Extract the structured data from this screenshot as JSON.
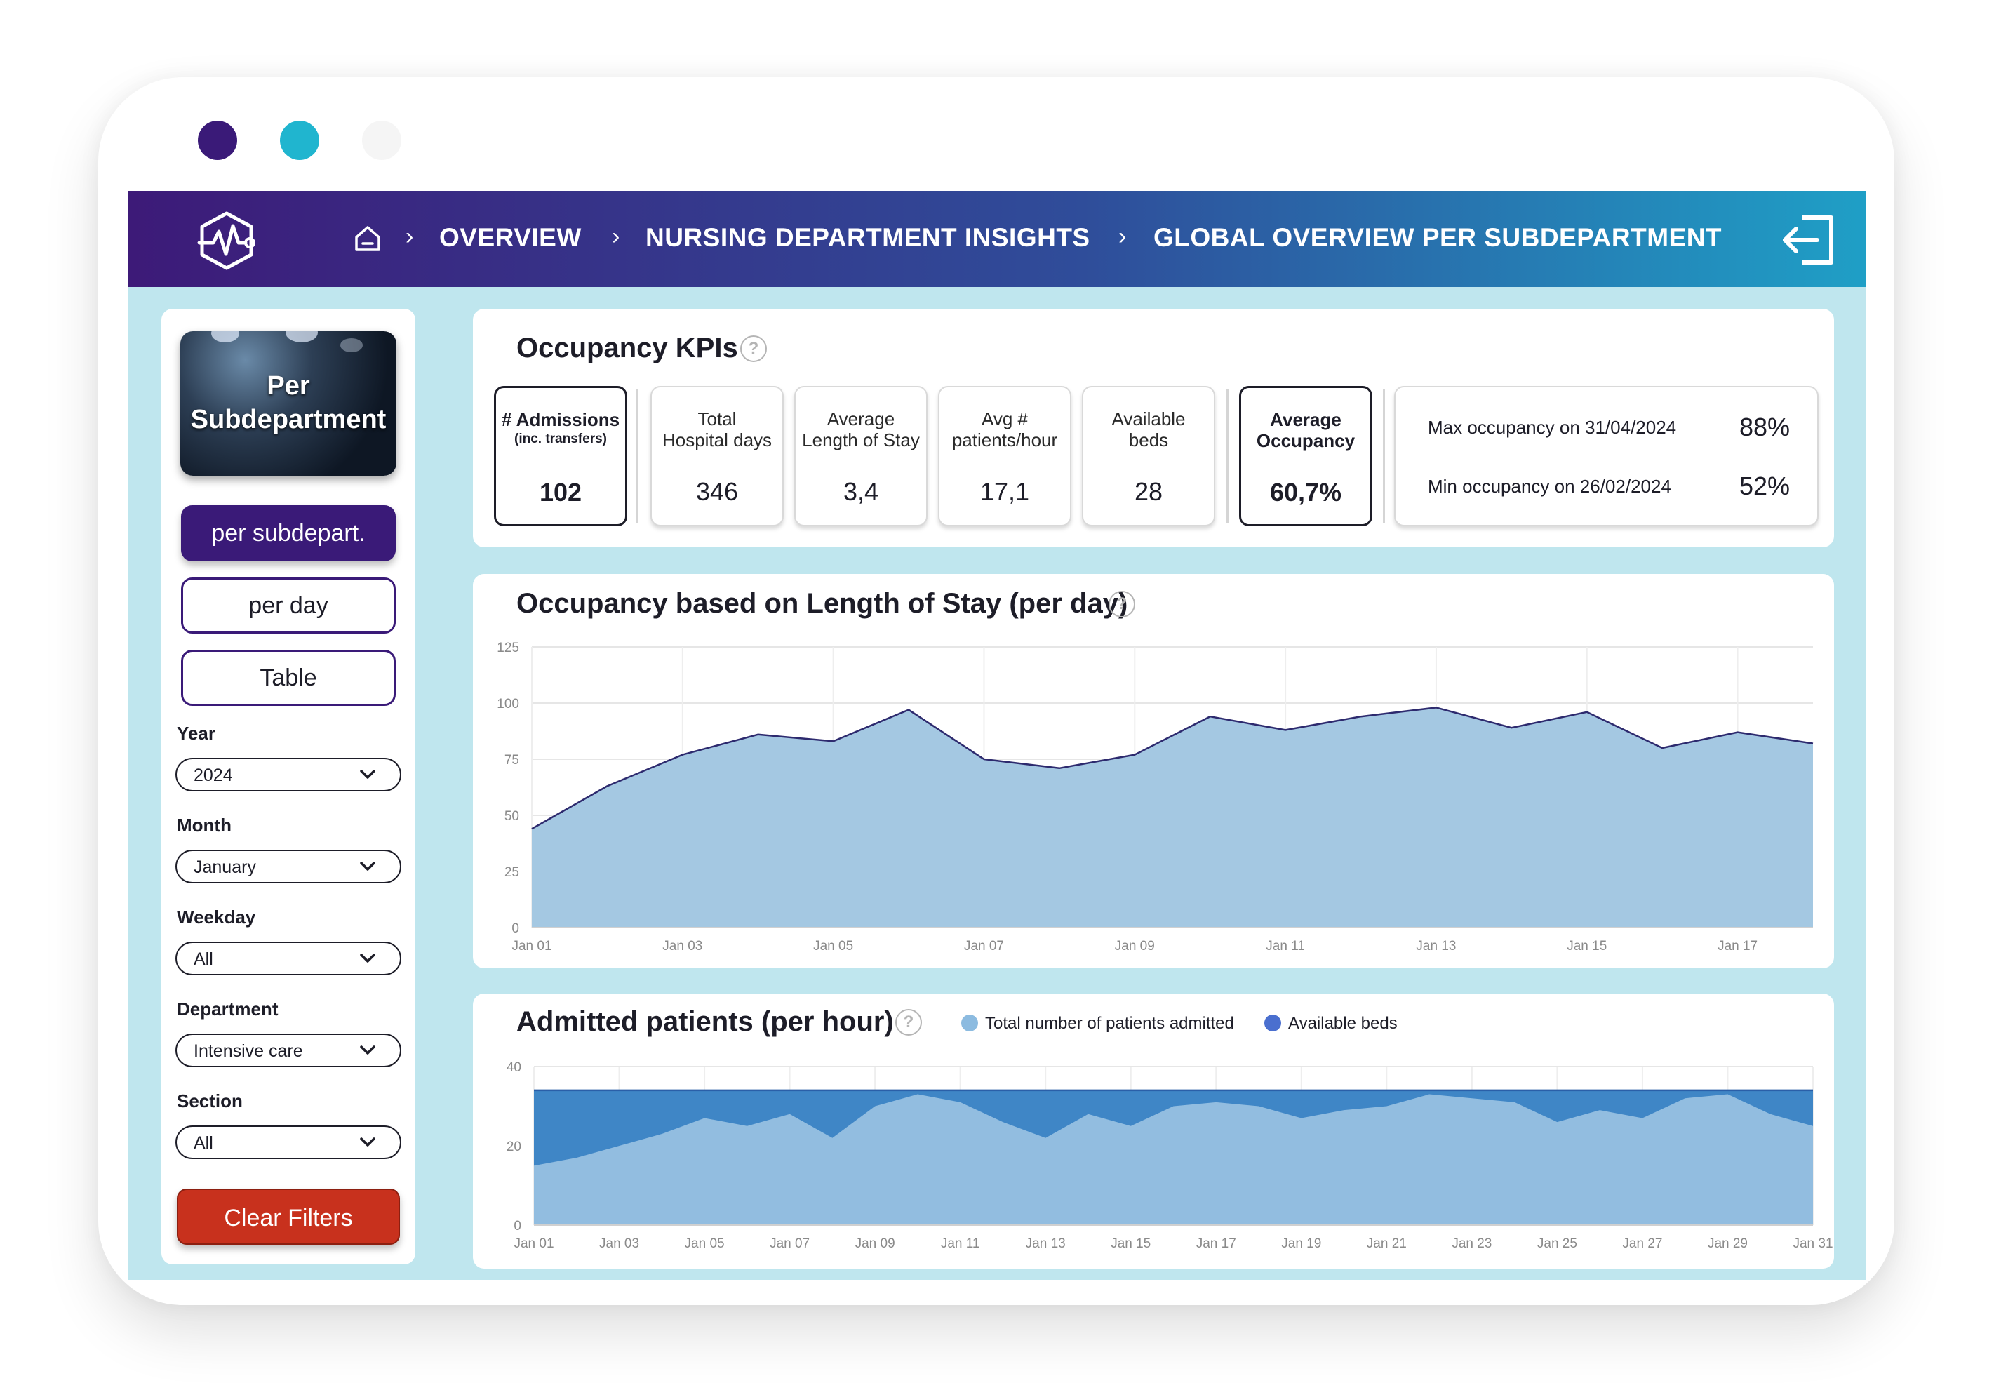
{
  "window": {
    "dot_colors": [
      "#3a1a78",
      "#20b5cf",
      "#f5f5f5"
    ]
  },
  "header": {
    "logo_icon": "heart-pulse-hexagon-icon",
    "home_icon": "home-icon",
    "breadcrumbs": [
      "OVERVIEW",
      "NURSING DEPARTMENT INSIGHTS",
      "GLOBAL OVERVIEW PER SUBDEPARTMENT"
    ],
    "separator": "›",
    "exit_icon": "logout-icon"
  },
  "sidebar": {
    "hero_title_line1": "Per",
    "hero_title_line2": "Subdepartment",
    "view_buttons": [
      "per subdepart.",
      "per day",
      "Table"
    ],
    "active_view": "per subdepart.",
    "filters": [
      {
        "label": "Year",
        "value": "2024"
      },
      {
        "label": "Month",
        "value": "January"
      },
      {
        "label": "Weekday",
        "value": "All"
      },
      {
        "label": "Department",
        "value": "Intensive care"
      },
      {
        "label": "Section",
        "value": "All"
      }
    ],
    "clear_label": "Clear Filters"
  },
  "kpis": {
    "title": "Occupancy KPIs",
    "help": "?",
    "cards": [
      {
        "label1": "# Admissions",
        "label2": "(inc. transfers)",
        "value": "102"
      },
      {
        "label1": "Total",
        "label2": "Hospital days",
        "value": "346"
      },
      {
        "label1": "Average",
        "label2": "Length of Stay",
        "value": "3,4"
      },
      {
        "label1": "Avg #",
        "label2": "patients/hour",
        "value": "17,1"
      },
      {
        "label1": "Available",
        "label2": "beds",
        "value": "28"
      },
      {
        "label1": "Average",
        "label2": "Occupancy",
        "value": "60,7%"
      }
    ],
    "max_label": "Max occupancy on 31/04/2024",
    "max_value": "88%",
    "min_label": "Min occupancy  on 26/02/2024",
    "min_value": "52%"
  },
  "chart1_title": "Occupancy based on Length of Stay (per day)",
  "chart2_title": "Admitted patients (per hour)",
  "chart_data": [
    {
      "type": "area",
      "title": "Occupancy based on Length of Stay (per day)",
      "x": [
        "Jan 01",
        "Jan 02",
        "Jan 03",
        "Jan 04",
        "Jan 05",
        "Jan 06",
        "Jan 07",
        "Jan 08",
        "Jan 09",
        "Jan 10",
        "Jan 11",
        "Jan 12",
        "Jan 13",
        "Jan 14",
        "Jan 15",
        "Jan 16",
        "Jan 17",
        "Jan 18"
      ],
      "x_tick_labels": [
        "Jan 01",
        "Jan 03",
        "Jan 05",
        "Jan 07",
        "Jan 09",
        "Jan 11",
        "Jan 13",
        "Jan 15",
        "Jan 17"
      ],
      "series": [
        {
          "values": [
            44,
            63,
            77,
            86,
            83,
            97,
            75,
            71,
            77,
            94,
            88,
            94,
            98,
            89,
            96,
            80,
            87,
            82
          ],
          "color": "#a4c8e2",
          "line_color": "#2d2a6e"
        }
      ],
      "ylim": [
        0,
        125
      ],
      "yticks": [
        0,
        25,
        50,
        75,
        100,
        125
      ],
      "grid": true
    },
    {
      "type": "area",
      "title": "Admitted patients (per hour)",
      "x": [
        "Jan 01",
        "Jan 02",
        "Jan 03",
        "Jan 04",
        "Jan 05",
        "Jan 06",
        "Jan 07",
        "Jan 08",
        "Jan 09",
        "Jan 10",
        "Jan 11",
        "Jan 12",
        "Jan 13",
        "Jan 14",
        "Jan 15",
        "Jan 16",
        "Jan 17",
        "Jan 18",
        "Jan 19",
        "Jan 20",
        "Jan 21",
        "Jan 22",
        "Jan 23",
        "Jan 24",
        "Jan 25",
        "Jan 26",
        "Jan 27",
        "Jan 28",
        "Jan 29",
        "Jan 30",
        "Jan 31"
      ],
      "x_tick_labels": [
        "Jan 01",
        "Jan 03",
        "Jan 05",
        "Jan 07",
        "Jan 09",
        "Jan 11",
        "Jan 13",
        "Jan 15",
        "Jan 17",
        "Jan 19",
        "Jan 21",
        "Jan 23",
        "Jan 25",
        "Jan 27",
        "Jan 29",
        "Jan 31"
      ],
      "series": [
        {
          "name": "Available beds",
          "values": [
            34,
            34,
            34,
            34,
            34,
            34,
            34,
            34,
            34,
            34,
            34,
            34,
            34,
            34,
            34,
            34,
            34,
            34,
            34,
            34,
            34,
            34,
            34,
            34,
            34,
            34,
            34,
            34,
            34,
            34,
            34
          ],
          "color": "#3f86c6",
          "line_color": "#2a5fa8"
        },
        {
          "name": "Total number of patients admitted",
          "values": [
            15,
            17,
            20,
            23,
            27,
            25,
            28,
            22,
            30,
            33,
            31,
            26,
            22,
            28,
            25,
            30,
            31,
            30,
            27,
            29,
            30,
            33,
            32,
            31,
            26,
            29,
            27,
            32,
            33,
            28,
            25
          ],
          "color": "#92bde0"
        }
      ],
      "legend": [
        {
          "label": "Total number of patients admitted",
          "color": "#8cbbe0"
        },
        {
          "label": "Available beds",
          "color": "#4a6fcf"
        }
      ],
      "legend_placement": "top",
      "ylim": [
        0,
        40
      ],
      "yticks": [
        0,
        20,
        40
      ],
      "grid": true
    }
  ]
}
